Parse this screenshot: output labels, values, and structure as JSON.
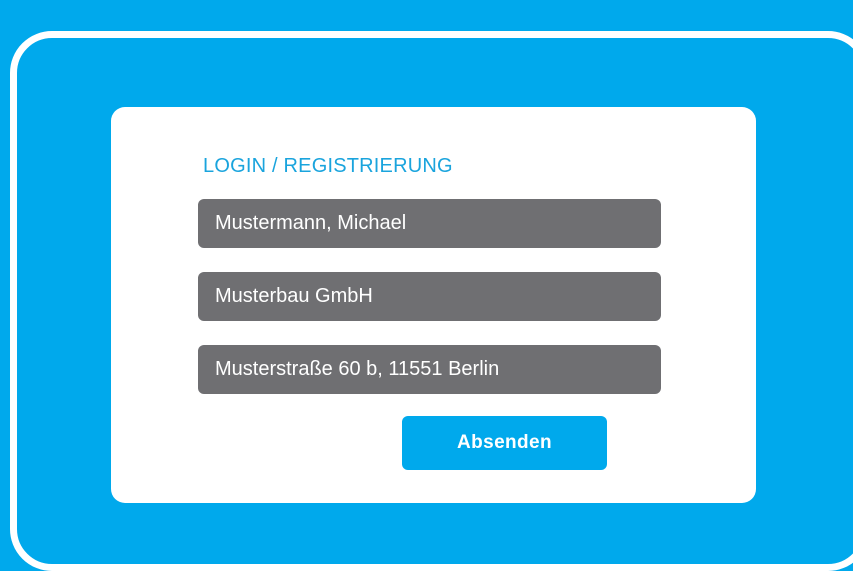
{
  "colors": {
    "background": "#00a9ec",
    "card": "#ffffff",
    "heading": "#1aa4dd",
    "field": "#6f6f72",
    "button": "#00a9ec"
  },
  "form": {
    "heading": "LOGIN / REGISTRIERUNG",
    "fields": [
      {
        "value": "Mustermann, Michael"
      },
      {
        "value": "Musterbau GmbH"
      },
      {
        "value": "Musterstraße 60 b, 11551 Berlin"
      }
    ],
    "submit_label": "Absenden"
  }
}
